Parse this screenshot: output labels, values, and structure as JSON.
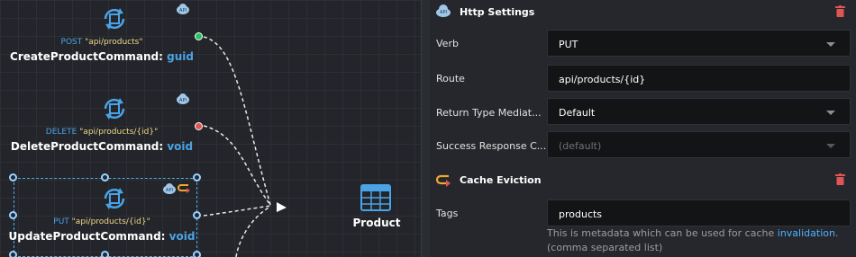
{
  "nodes": [
    {
      "verb": "POST",
      "route": "\"api/products\"",
      "name": "CreateProductCommand:",
      "ret": "guid"
    },
    {
      "verb": "DELETE",
      "route": "\"api/products/{id}\"",
      "name": "DeleteProductCommand:",
      "ret": "void"
    },
    {
      "verb": "PUT",
      "route": "\"api/products/{id}\"",
      "name": "UpdateProductCommand:",
      "ret": "void"
    }
  ],
  "entity": {
    "label": "Product"
  },
  "icons": {
    "command": "command-cycle-icon",
    "http": "cloud-api-icon",
    "cache": "cache-eviction-icon",
    "entity": "entity-table-icon",
    "delete": "trash-icon"
  },
  "colors": {
    "accent": "#4aa3e6",
    "route": "#f0d88a",
    "port_ok": "#22c55e",
    "port_err": "#e05555",
    "danger": "#e05555",
    "link": "#4fb3ff"
  },
  "http_settings": {
    "title": "Http Settings",
    "verb_label": "Verb",
    "verb_value": "PUT",
    "route_label": "Route",
    "route_value": "api/products/{id}",
    "return_label": "Return Type Mediat...",
    "return_value": "Default",
    "success_label": "Success Response C...",
    "success_placeholder": "(default)"
  },
  "cache_eviction": {
    "title": "Cache Eviction",
    "tags_label": "Tags",
    "tags_value": "products",
    "hint_before": "This is metadata which can be used for cache ",
    "hint_link": "invalidation",
    "hint_after": ".(comma separated list)"
  }
}
